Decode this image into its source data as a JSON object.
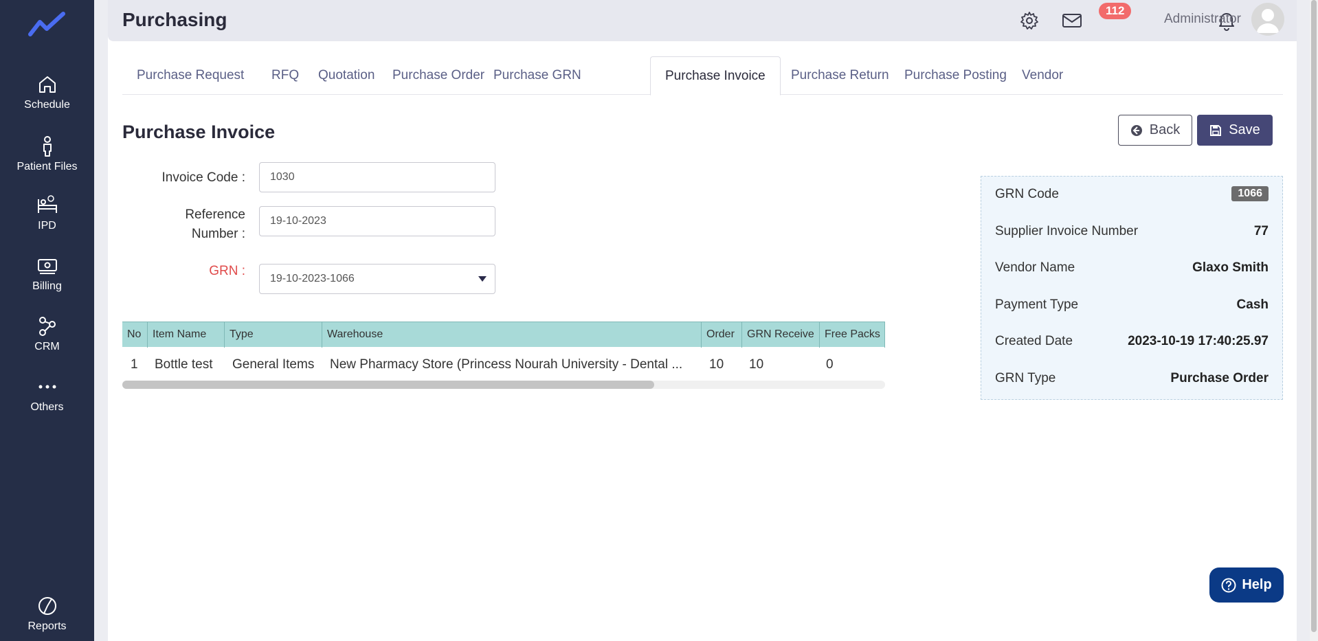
{
  "sidebar": {
    "items": [
      {
        "label": "Schedule",
        "icon": "home-icon"
      },
      {
        "label": "Patient Files",
        "icon": "person-icon"
      },
      {
        "label": "IPD",
        "icon": "bed-icon"
      },
      {
        "label": "Billing",
        "icon": "money-icon"
      },
      {
        "label": "CRM",
        "icon": "network-icon"
      },
      {
        "label": "Others",
        "icon": "dots-icon"
      },
      {
        "label": "Reports",
        "icon": "pie-chart-icon"
      }
    ]
  },
  "header": {
    "title": "Purchasing",
    "notification_count": "112",
    "user_name": "Administrator"
  },
  "tabs": [
    {
      "label": "Purchase Request"
    },
    {
      "label": "RFQ"
    },
    {
      "label": "Quotation"
    },
    {
      "label": "Purchase Order"
    },
    {
      "label": "Purchase GRN"
    },
    {
      "label": "Purchase Invoice",
      "active": true
    },
    {
      "label": "Purchase Return"
    },
    {
      "label": "Purchase Posting"
    },
    {
      "label": "Vendor"
    }
  ],
  "page": {
    "title": "Purchase Invoice",
    "back_label": "Back",
    "save_label": "Save"
  },
  "form": {
    "invoice_code_label": "Invoice Code :",
    "invoice_code_value": "1030",
    "reference_label_line1": "Reference",
    "reference_label_line2": "Number :",
    "reference_value": "19-10-2023",
    "grn_label": "GRN :",
    "grn_value": "19-10-2023-1066"
  },
  "table": {
    "columns": [
      "No",
      "Item Name",
      "Type",
      "Warehouse",
      "Order",
      "GRN Receive",
      "Free Packs"
    ],
    "rows": [
      [
        "1",
        "Bottle test",
        "General Items",
        "New Pharmacy Store (Princess Nourah University - Dental ...",
        "10",
        "10",
        "0"
      ]
    ]
  },
  "info": {
    "grn_code_label": "GRN Code",
    "grn_code_value": "1066",
    "supplier_invoice_label": "Supplier Invoice Number",
    "supplier_invoice_value": "77",
    "vendor_label": "Vendor Name",
    "vendor_value": "Glaxo Smith",
    "payment_label": "Payment Type",
    "payment_value": "Cash",
    "created_label": "Created Date",
    "created_value": "2023-10-19 17:40:25.97",
    "grn_type_label": "GRN Type",
    "grn_type_value": "Purchase Order"
  },
  "help_label": "Help",
  "colors": {
    "sidebar": "#252e47",
    "accent": "#454776",
    "table_header": "#a8dad8",
    "required": "#e04b4b",
    "help": "#0b3a86"
  }
}
